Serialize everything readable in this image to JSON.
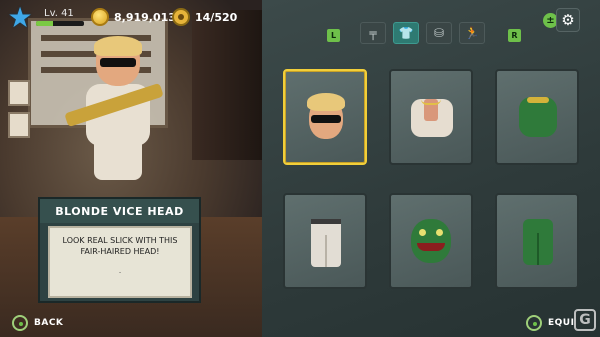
{
  "hud": {
    "level": "Lv. 41",
    "xp_fraction": 0.35,
    "coins": "8,919,013",
    "film_progress": "14/520"
  },
  "info_card": {
    "title": "BLONDE VICE HEAD",
    "description": "LOOK REAL SLICK WITH THIS FAIR-HAIRED HEAD!",
    "dot": "."
  },
  "tabs": {
    "left_shoulder": "L",
    "right_shoulder": "R",
    "items": [
      {
        "icon": "pistol-icon",
        "glyph": "╤"
      },
      {
        "icon": "shirt-icon",
        "glyph": "👕"
      },
      {
        "icon": "bag-icon",
        "glyph": "⛁"
      },
      {
        "icon": "pose-icon",
        "glyph": "🏃"
      }
    ]
  },
  "toggle_icon": "±",
  "gear_icon": "⚙",
  "items": [
    {
      "name": "blonde-vice-head",
      "selected": true
    },
    {
      "name": "white-shirt",
      "selected": false
    },
    {
      "name": "lizard-body",
      "selected": false
    },
    {
      "name": "white-pants",
      "selected": false
    },
    {
      "name": "lizard-head",
      "selected": false
    },
    {
      "name": "lizard-legs",
      "selected": false
    }
  ],
  "controls": {
    "back_label": "BACK",
    "equip_label": "EQUI"
  },
  "watermark": "G",
  "colors": {
    "selected_border": "#f2cf3a",
    "button_green": "#6ec04a",
    "active_tab": "#2e7a72",
    "star_blue": "#3fa8e8"
  }
}
